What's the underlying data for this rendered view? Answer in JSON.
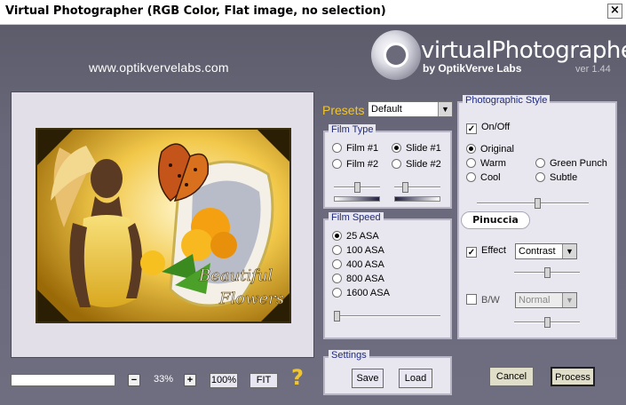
{
  "window": {
    "title": "Virtual Photographer (RGB Color, Flat image, no selection)",
    "close_label": "×"
  },
  "header": {
    "website": "www.optikvervelabs.com",
    "logo_text": "virtualPhotographer",
    "logo_sub": "by OptikVerve Labs",
    "version": "ver 1.44"
  },
  "presets": {
    "label": "Presets",
    "selected": "Default"
  },
  "film_type": {
    "legend": "Film Type",
    "options": [
      "Film #1",
      "Slide #1",
      "Film #2",
      "Slide #2"
    ],
    "selected": "Slide #1",
    "slider1_level": 0.5,
    "slider2_level": 0.2
  },
  "film_speed": {
    "legend": "Film Speed",
    "options": [
      "25 ASA",
      "100 ASA",
      "400 ASA",
      "800 ASA",
      "1600 ASA"
    ],
    "selected": "25 ASA",
    "slider_level": 0.0
  },
  "settings": {
    "legend": "Settings",
    "save_label": "Save",
    "load_label": "Load"
  },
  "photo_style": {
    "legend": "Photographic Style",
    "onoff_label": "On/Off",
    "onoff_checked": true,
    "styles": [
      "Original",
      "Green Punch",
      "Warm",
      "Subtle",
      "Cool"
    ],
    "selected": "Original",
    "style_slider_level": 0.55,
    "badge": "Pinuccia",
    "effect_label": "Effect",
    "effect_checked": true,
    "effect_selected": "Contrast",
    "effect_slider_level": 0.5,
    "bw_label": "B/W",
    "bw_checked": false,
    "bw_selected": "Normal",
    "bw_slider_level": 0.5
  },
  "zoom": {
    "minus": "−",
    "plus": "+",
    "value": "33%",
    "hundred_label": "100%",
    "fit_label": "FIT",
    "help": "?"
  },
  "actions": {
    "cancel_label": "Cancel",
    "process_label": "Process"
  },
  "preview_image": {
    "caption_line1": "Beautiful",
    "caption_line2": "Flowers"
  }
}
